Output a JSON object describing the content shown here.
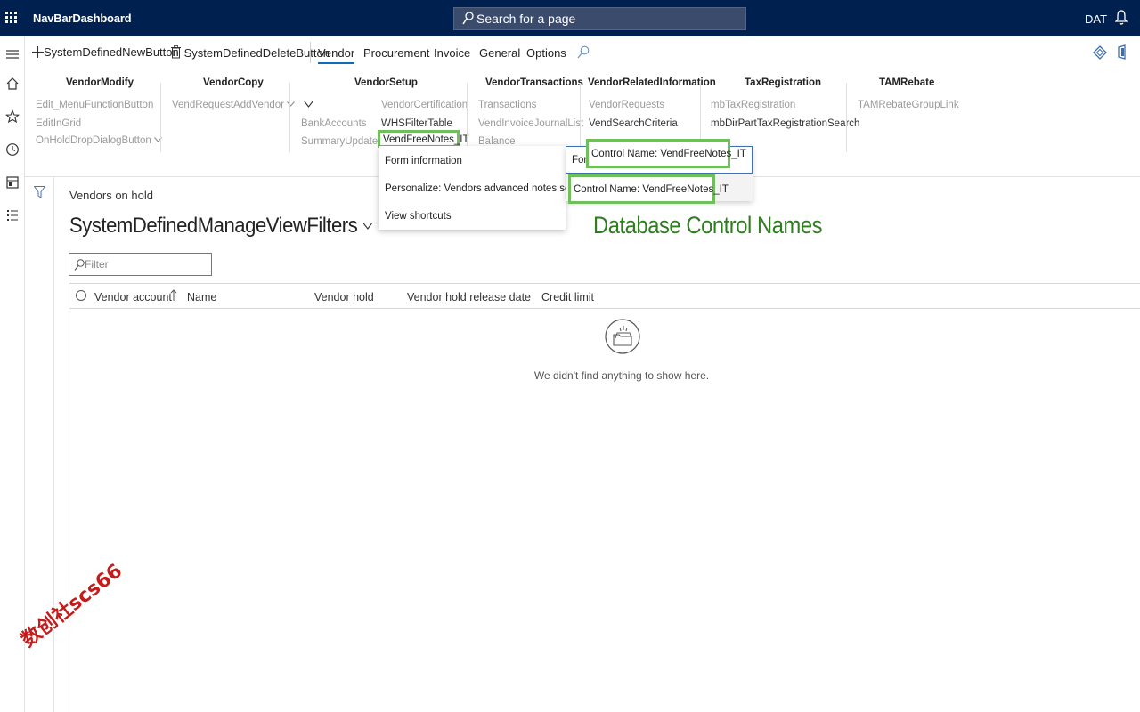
{
  "topbar": {
    "app_title": "NavBarDashboard",
    "search_placeholder": "Search for a page",
    "company": "DAT"
  },
  "actionpane": {
    "new_button": "SystemDefinedNewButton",
    "delete_button": "SystemDefinedDeleteButton",
    "tabs": [
      "Vendor",
      "Procurement",
      "Invoice",
      "General",
      "Options"
    ],
    "active_tab": "Vendor"
  },
  "ribbon": {
    "groups": [
      {
        "title": "VendorModify",
        "items": [
          "Edit_MenuFunctionButton",
          "EditInGrid",
          "OnHoldDropDialogButton"
        ]
      },
      {
        "title": "VendorCopy",
        "items": [
          "VendRequestAddVendor"
        ]
      },
      {
        "title": "VendorSetup",
        "items": [
          "BankAccounts",
          "SummaryUpdate",
          "VendorCertification",
          "WHSFilterTable",
          "VendFreeNotes_IT"
        ]
      },
      {
        "title": "VendorTransactions",
        "items": [
          "Transactions",
          "VendInvoiceJournalList",
          "Balance"
        ]
      },
      {
        "title": "VendorRelatedInformation",
        "items": [
          "VendorRequests",
          "VendSearchCriteria"
        ]
      },
      {
        "title": "TaxRegistration",
        "items": [
          "mbTaxRegistration",
          "mbDirPartTaxRegistrationSearch"
        ]
      },
      {
        "title": "TAMRebate",
        "items": [
          "TAMRebateGroupLink"
        ]
      }
    ]
  },
  "context_menu": {
    "items": [
      "Form information",
      "Personalize: Vendors advanced notes setup",
      "View shortcuts"
    ],
    "sub_prefix": "For",
    "control_name_1": "Control Name: VendFreeNotes_IT",
    "control_name_2": "Control Name: VendFreeNotes_IT"
  },
  "annotation": "Database Control Names",
  "main": {
    "caption": "Vendors on hold",
    "view_title": "SystemDefinedManageViewFilters",
    "filter_placeholder": "Filter",
    "columns": [
      "Vendor account",
      "Name",
      "Vendor hold",
      "Vendor hold release date",
      "Credit limit"
    ],
    "empty_message": "We didn't find anything to show here."
  },
  "watermark": "数创社scs66",
  "colors": {
    "nav_background": "#002050",
    "accent": "#0f6cbd",
    "highlight_border": "#6fbf5a",
    "annotation": "#2e7d1e",
    "watermark": "#c41b1b"
  }
}
